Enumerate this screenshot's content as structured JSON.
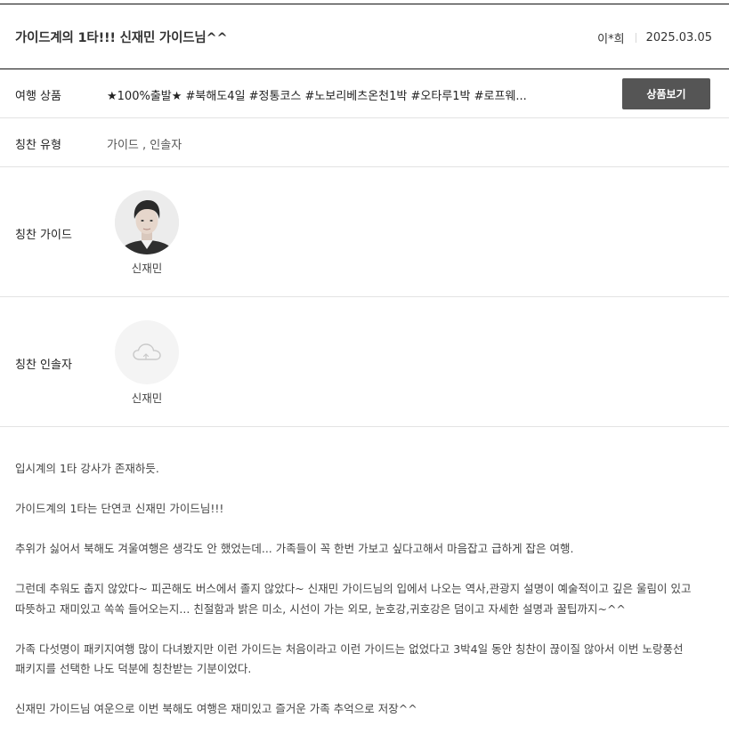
{
  "post": {
    "title": "가이드계의 1타!!! 신재민 가이드님^^",
    "author": "이*희",
    "date": "2025.03.05"
  },
  "product": {
    "label": "여행 상품",
    "value": "★100%출발★ #북해도4일 #정통코스 #노보리베츠온천1박 #오타루1박 #로프웨...",
    "button_label": "상품보기"
  },
  "praise_type": {
    "label": "칭찬 유형",
    "value": "가이드 , 인솔자"
  },
  "praise_guide": {
    "label": "칭찬 가이드",
    "name": "신재민"
  },
  "praise_leader": {
    "label": "칭찬 인솔자",
    "name": "신재민"
  },
  "review": {
    "paragraphs": [
      "입시계의 1타 강사가 존재하듯.",
      "가이드계의 1타는 단연코 신재민 가이드님!!!",
      "추위가 싫어서 북해도 겨울여행은 생각도 안 했었는데... 가족들이 꼭 한번 가보고 싶다고해서 마음잡고 급하게 잡은 여행.",
      "그런데 추워도 춥지 않았다~ 피곤해도 버스에서 졸지 않았다~ 신재민 가이드님의 입에서 나오는 역사,관광지 설명이 예술적이고 깊은 울림이 있고 따뜻하고 재미있고 쏙쏙 들어오는지... 친절함과 밝은 미소, 시선이 가는 외모, 눈호강,귀호강은 덤이고 자세한 설명과 꿀팁까지~^^",
      "가족 다섯명이 패키지여행 많이 다녀봤지만 이런 가이드는 처음이라고 이런 가이드는 없었다고 3박4일 동안 칭찬이 끊이질 않아서 이번 노랑풍선 패키지를 선택한 나도 덕분에 칭찬받는 기분이었다.",
      "신재민 가이드님 여운으로 이번 북해도 여행은 재미있고 즐거운 가족 추억으로 저장^^"
    ]
  }
}
